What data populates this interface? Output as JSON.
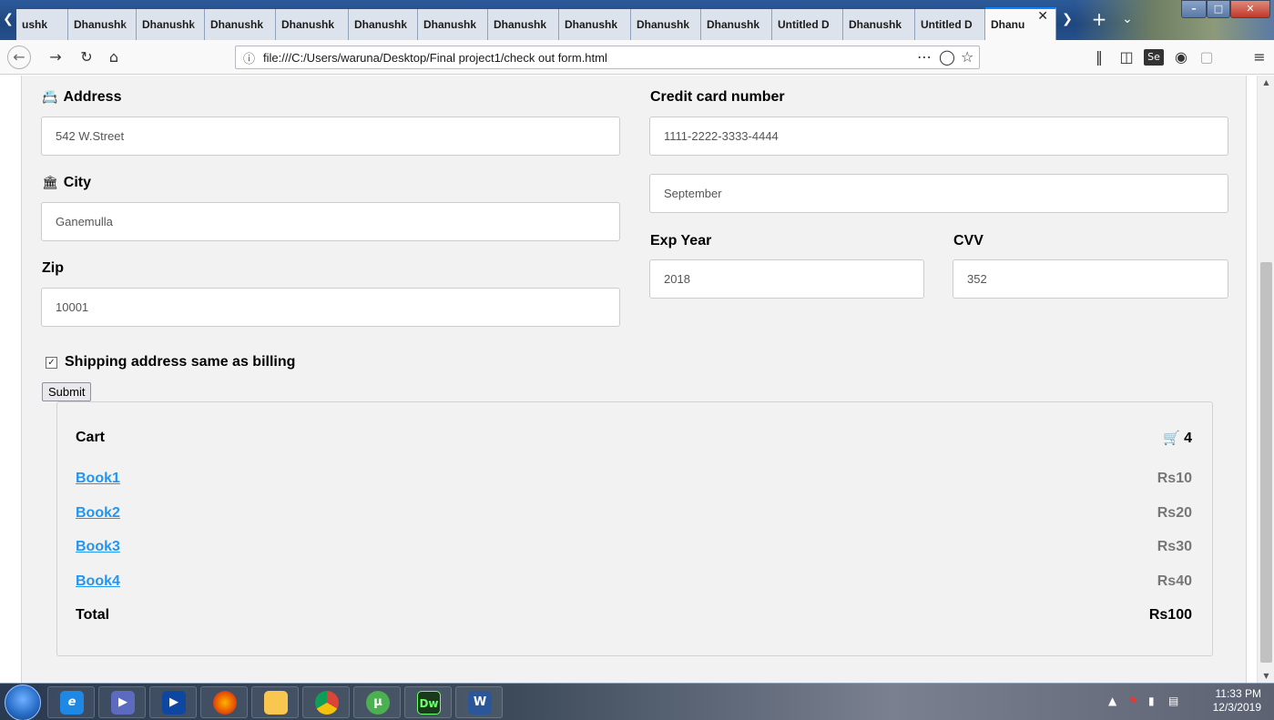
{
  "browser": {
    "tabs": [
      {
        "label": "ushk"
      },
      {
        "label": "Dhanushk"
      },
      {
        "label": "Dhanushk"
      },
      {
        "label": "Dhanushk"
      },
      {
        "label": "Dhanushk"
      },
      {
        "label": "Dhanushk"
      },
      {
        "label": "Dhanushk"
      },
      {
        "label": "Dhanushk"
      },
      {
        "label": "Dhanushk"
      },
      {
        "label": "Dhanushk"
      },
      {
        "label": "Dhanushk"
      },
      {
        "label": "Untitled D"
      },
      {
        "label": "Dhanushk"
      },
      {
        "label": "Untitled D"
      },
      {
        "label": "Dhanu"
      }
    ],
    "url": "file:///C:/Users/waruna/Desktop/Final project1/check out form.html"
  },
  "form": {
    "address_label": "Address",
    "address_value": "542 W.Street",
    "city_label": "City",
    "city_value": "Ganemulla",
    "zip_label": "Zip",
    "zip_value": "10001",
    "card_label": "Credit card number",
    "card_value": "1111-2222-3333-4444",
    "month_value": "September",
    "exp_year_label": "Exp Year",
    "exp_year_value": "2018",
    "cvv_label": "CVV",
    "cvv_value": "352",
    "shipping_label": "Shipping address same as billing",
    "shipping_checked": true,
    "submit_label": "Submit"
  },
  "cart": {
    "title": "Cart",
    "count": "4",
    "items": [
      {
        "name": "Book1",
        "price": "Rs10"
      },
      {
        "name": "Book2",
        "price": "Rs20"
      },
      {
        "name": "Book3",
        "price": "Rs30"
      },
      {
        "name": "Book4",
        "price": "Rs40"
      }
    ],
    "total_label": "Total",
    "total_value": "Rs100"
  },
  "taskbar": {
    "dw_label": "Dw",
    "word_label": "W",
    "time": "11:33 PM",
    "date": "12/3/2019"
  },
  "colors": {
    "link": "#2196f3",
    "price": "#777777",
    "form_bg": "#f2f2f2",
    "active_tab_accent": "#0a84ff"
  }
}
